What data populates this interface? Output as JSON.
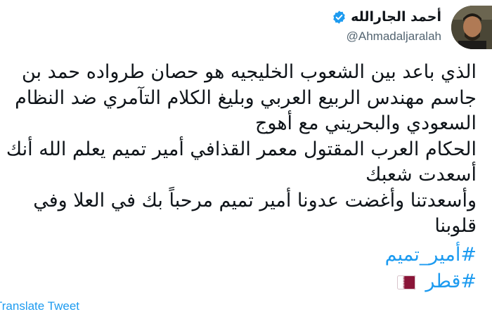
{
  "author": {
    "display_name": "أحمد الجارالله",
    "handle": "@Ahmadaljaralah",
    "verified": true
  },
  "tweet": {
    "lines": [
      "الذي باعد بين الشعوب الخليجيه هو حصان طرواده حمد بن",
      "جاسم مهندس الربيع العربي وبليغ الكلام التآمري ضد النظام",
      "السعودي والبحريني مع أهوج",
      "الحكام العرب المقتول معمر القذافي أمير تميم يعلم الله أنك",
      "أسعدت شعبك",
      "وأسعدتنا وأغضت عدونا أمير تميم مرحباً بك في العلا وفي",
      "قلوبنا"
    ],
    "hashtags": [
      "#أمير_تميم",
      "#قطر"
    ],
    "translate_label": "Translate Tweet"
  },
  "icons": {
    "more": "more-icon",
    "verified": "verified-badge-icon",
    "flag": "qatar-flag-icon"
  },
  "colors": {
    "link": "#1d9bf0",
    "verified": "#1d9bf0",
    "qatar_maroon": "#8a1538"
  }
}
